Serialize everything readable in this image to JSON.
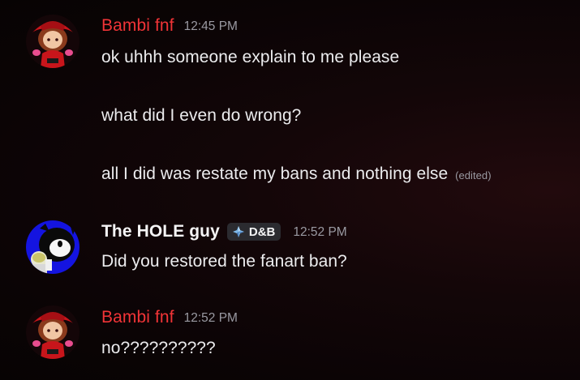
{
  "messages": [
    {
      "author": "Bambi fnf",
      "timestamp": "12:45 PM",
      "lines": [
        "ok uhhh someone explain to me please",
        "what did I even do wrong?",
        "all I did was restate my bans and nothing else"
      ],
      "edited_label": "(edited)"
    },
    {
      "author": "The HOLE guy",
      "role_tag": "D&B",
      "timestamp": "12:52 PM",
      "lines": [
        "Did you restored the fanart ban?"
      ]
    },
    {
      "author": "Bambi fnf",
      "timestamp": "12:52 PM",
      "lines": [
        "no??????????"
      ]
    }
  ],
  "colors": {
    "author_red": "#f13437",
    "author_white": "#f4f4f5",
    "timestamp": "#9a9aa2",
    "text": "#ececee",
    "role_tag_bg": "#2b2b30"
  },
  "icons": {
    "avatar_1": "red-hat-character-avatar",
    "avatar_2": "ink-character-avatar",
    "role_tag_icon": "diamond-role-icon"
  }
}
